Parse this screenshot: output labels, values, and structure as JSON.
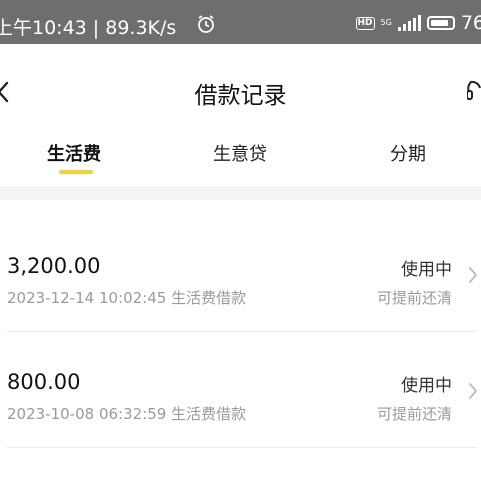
{
  "statusbar": {
    "time": "上午10:43 | 89.3K/s",
    "network_label": "5G",
    "hd_label": "HD",
    "battery_text": "76"
  },
  "header": {
    "title": "借款记录",
    "back_icon": "chevron-left-icon",
    "service_icon": "headset-icon"
  },
  "tabs": [
    {
      "label": "生活费",
      "active": true
    },
    {
      "label": "生意贷",
      "active": false
    },
    {
      "label": "分期",
      "active": false
    }
  ],
  "records": [
    {
      "amount": "3,200.00",
      "meta": "2023-12-14 10:02:45 生活费借款",
      "status": "使用中",
      "action": "可提前还清"
    },
    {
      "amount": "800.00",
      "meta": "2023-10-08 06:32:59 生活费借款",
      "status": "使用中",
      "action": "可提前还清"
    }
  ],
  "colors": {
    "accent_underline": "#f2d331",
    "statusbar_bg": "#6e6e6e",
    "muted_text": "#9a9a9a"
  }
}
